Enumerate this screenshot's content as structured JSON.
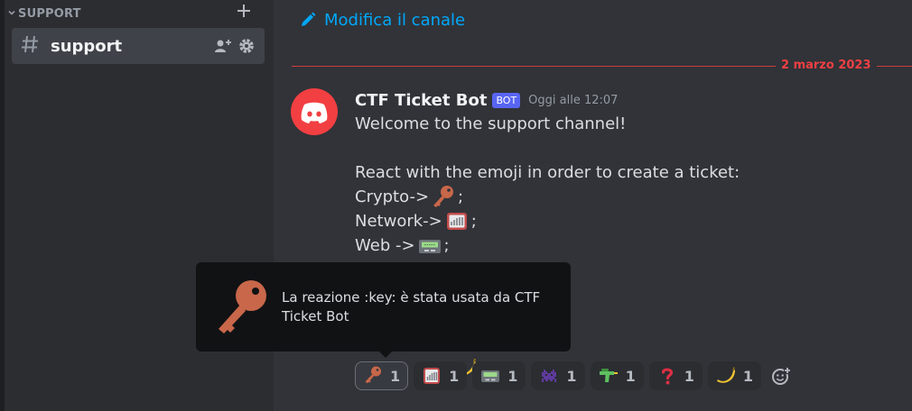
{
  "sidebar": {
    "category_label": "SUPPORT",
    "channel": {
      "name": "support"
    }
  },
  "main": {
    "edit_channel_label": "Modifica il canale",
    "date_divider": "2 marzo 2023"
  },
  "message": {
    "author": "CTF Ticket Bot",
    "badge": "BOT",
    "timestamp": "Oggi alle 12:07",
    "lines": {
      "l1": "Welcome to the support channel!",
      "l3": "React with the emoji in order to create a ticket:",
      "crypto": "Crypto->",
      "crypto_end": ";",
      "network": "Network->",
      "network_end": ";",
      "web": "Web ->",
      "web_end": ";",
      "partial_end": ";"
    }
  },
  "reactions": [
    {
      "emoji": "key",
      "count": "1",
      "selected": true
    },
    {
      "emoji": "signal",
      "count": "1"
    },
    {
      "emoji": "pager",
      "count": "1"
    },
    {
      "emoji": "space-invader",
      "count": "1"
    },
    {
      "emoji": "water-pistol",
      "count": "1"
    },
    {
      "emoji": "question",
      "count": "1"
    },
    {
      "emoji": "banana",
      "count": "1"
    }
  ],
  "tooltip": {
    "text": "La reazione :key: è stata usata da CTF Ticket Bot",
    "emoji": "key"
  },
  "colors": {
    "accent_link": "#00a8fc",
    "date_divider": "#f23f43",
    "bot_badge": "#5865f2",
    "avatar": "#f23f42"
  }
}
